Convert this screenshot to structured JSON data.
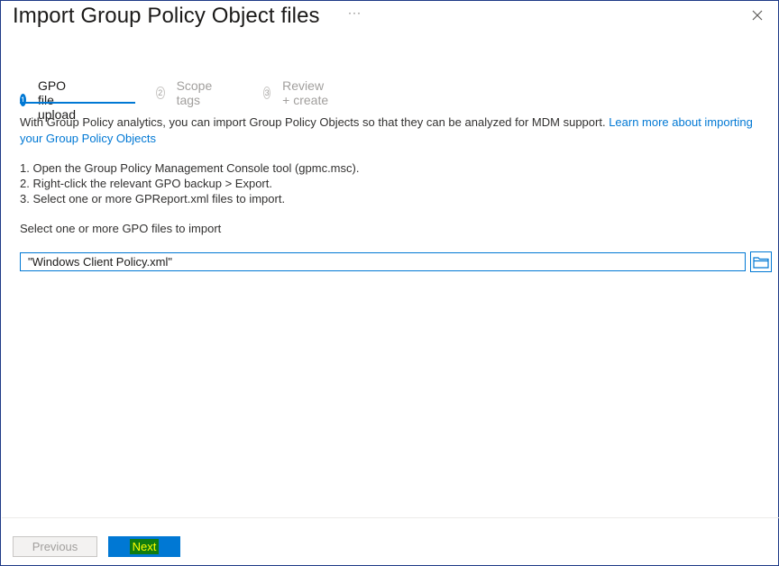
{
  "window": {
    "title": "Import Group Policy Object files",
    "more_label": "···"
  },
  "steps": [
    {
      "num": "1",
      "label": "GPO file upload"
    },
    {
      "num": "2",
      "label": "Scope tags"
    },
    {
      "num": "3",
      "label": "Review + create"
    }
  ],
  "intro": {
    "text": "With Group Policy analytics, you can import Group Policy Objects so that they can be analyzed for MDM support. ",
    "link": "Learn more about importing your Group Policy Objects"
  },
  "instructions": [
    "1. Open the Group Policy Management Console tool (gpmc.msc).",
    "2. Right-click the relevant GPO backup > Export.",
    "3. Select one or more GPReport.xml files to import."
  ],
  "file_select": {
    "label": "Select one or more GPO files to import",
    "value": "\"Windows Client Policy.xml\""
  },
  "footer": {
    "previous_label": "Previous",
    "next_label": "Next"
  },
  "colors": {
    "accent": "#0078d4",
    "frame_border": "#1f3b87",
    "highlight_bg": "#107c10",
    "highlight_text": "#ffff00"
  }
}
